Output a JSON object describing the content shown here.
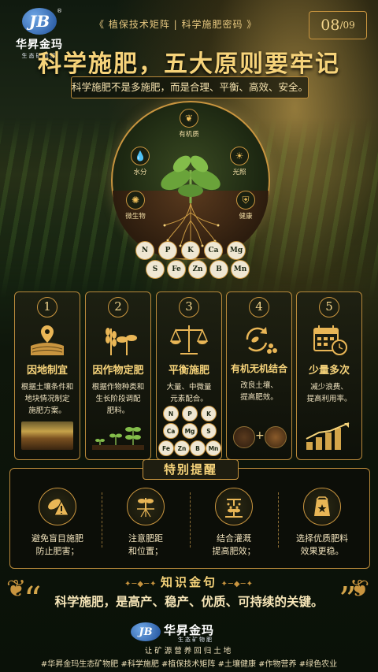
{
  "header": {
    "brand_mark": "JB",
    "brand_name": "华昇金玛",
    "brand_sub": "生态矿物肥",
    "registered": "®",
    "breadcrumb": "《 植保技术矩阵 | 科学施肥密码 》",
    "page_current": "08",
    "page_total": "/09"
  },
  "title": "科学施肥，五大原则要牢记",
  "subtitle": "科学施肥不是多施肥，而是合理、平衡、高效、安全。",
  "factors": [
    {
      "label": "有机质",
      "icon": "leaf-icon"
    },
    {
      "label": "水分",
      "icon": "water-drop-icon"
    },
    {
      "label": "光照",
      "icon": "sun-icon"
    },
    {
      "label": "微生物",
      "icon": "microbe-icon"
    },
    {
      "label": "健康",
      "icon": "shield-check-icon"
    }
  ],
  "elements_row1": [
    "N",
    "P",
    "K",
    "Ca",
    "Mg"
  ],
  "elements_row2": [
    "S",
    "Fe",
    "Zn",
    "B",
    "Mn"
  ],
  "principles": [
    {
      "num": "1",
      "title": "因地制宜",
      "desc": "根据土壤条件和\n地块情况制定\n施肥方案。",
      "icon": "field-location-icon"
    },
    {
      "num": "2",
      "title": "因作物定肥",
      "desc": "根据作物种类和\n生长阶段调配\n肥料。",
      "icon": "crops-icon"
    },
    {
      "num": "3",
      "title": "平衡施肥",
      "desc": "大量、中微量\n元素配合。",
      "icon": "balance-scale-icon"
    },
    {
      "num": "4",
      "title": "有机无机结合",
      "desc": "改良土壤、\n提高肥效。",
      "icon": "organic-cycle-icon"
    },
    {
      "num": "5",
      "title": "少量多次",
      "desc": "减少浪费、\n提高利用率。",
      "icon": "calendar-clock-icon"
    }
  ],
  "card3_elements": [
    "N",
    "P",
    "K",
    "Ca",
    "Mg",
    "S",
    "Fe",
    "Zn",
    "B",
    "Mn"
  ],
  "card4_plus": "+",
  "reminder": {
    "title": "特别提醒",
    "items": [
      {
        "text": "避免盲目施肥\n防止肥害；",
        "icon": "warning-leaf-icon"
      },
      {
        "text": "注意肥距\n和位置；",
        "icon": "plant-roots-icon"
      },
      {
        "text": "结合灌溉\n提高肥效；",
        "icon": "irrigation-icon"
      },
      {
        "text": "选择优质肥料\n效果更稳。",
        "icon": "fertilizer-bag-icon"
      }
    ]
  },
  "quote": {
    "title": "知识金句",
    "text": "科学施肥，是高产、稳产、优质、可持续的关键。",
    "open_mark": "“",
    "close_mark": "”"
  },
  "footer": {
    "brand_mark": "JB",
    "brand_name": "华昇金玛",
    "brand_sub": "生态矿物肥",
    "slogan": "让矿源营养回归土地",
    "hashtags": "#华昇金玛生态矿物肥  #科学施肥  #植保技术矩阵  #土壤健康  #作物营养  #绿色农业"
  },
  "colors": {
    "gold": "#e9c46a",
    "dark_bg": "#0b1208",
    "brand_blue": "#1f4f99"
  }
}
